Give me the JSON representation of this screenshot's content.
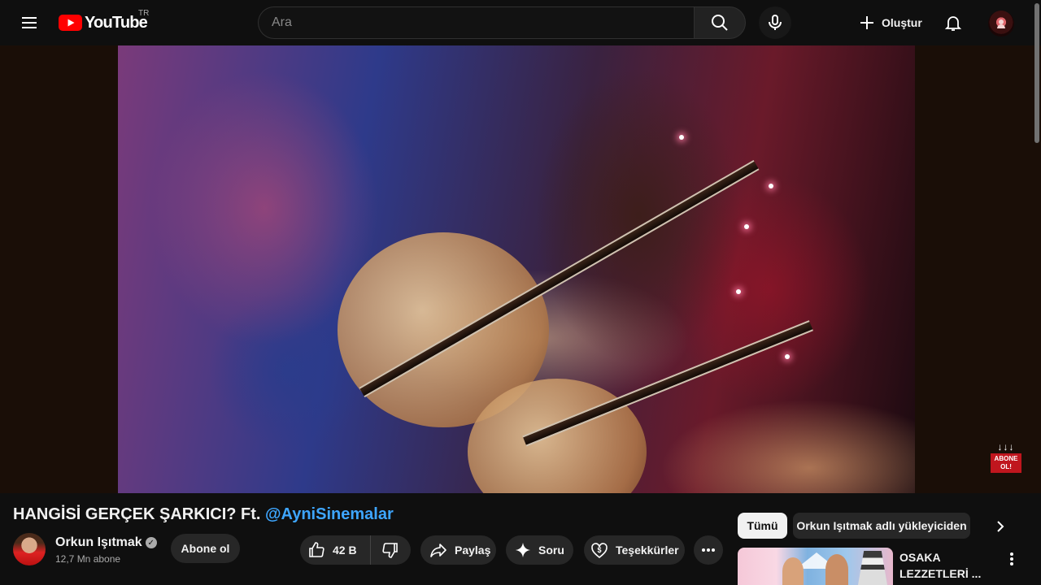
{
  "header": {
    "logo_text": "YouTube",
    "country_code": "TR",
    "search_placeholder": "Ara",
    "create_label": "Oluştur",
    "icons": [
      "menu-icon",
      "search-icon",
      "mic-icon",
      "plus-icon",
      "bell-icon",
      "avatar"
    ]
  },
  "player": {
    "watermark_arrows": "↓↓↓",
    "watermark_label": "ABONE OL!"
  },
  "video": {
    "title": "HANGİSİ GERÇEK ŞARKICI? Ft. ",
    "title_mention": "@AyniSinemalar"
  },
  "channel": {
    "name": "Orkun Işıtmak",
    "subscribers": "12,7 Mn abone",
    "subscribe_label": "Abone ol"
  },
  "actions": {
    "like_count": "42 B",
    "share_label": "Paylaş",
    "ask_label": "Soru",
    "thanks_label": "Teşekkürler"
  },
  "sidebar": {
    "chips": [
      "Tümü",
      "Orkun Işıtmak adlı yükleyiciden"
    ],
    "active_chip": "Tümü",
    "recommendation": {
      "title_line1": "OSAKA",
      "title_line2": "LEZZETLERİ ..."
    }
  },
  "colors": {
    "background": "#0f0f0f",
    "brand_red": "#ff0000",
    "link_blue": "#3ea6ff",
    "pill_bg": "#272727"
  }
}
